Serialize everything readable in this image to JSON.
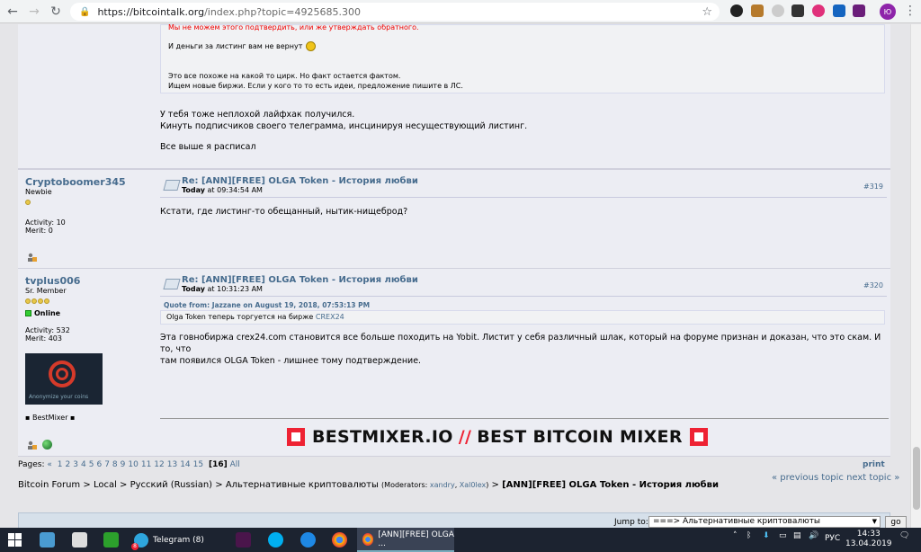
{
  "browser": {
    "url_host": "https://bitcointalk.org",
    "url_path": "/index.php?topic=4925685.300",
    "profile_initials": "Ю"
  },
  "post_prev": {
    "quote_lines": {
      "line1": "Мы не можем этого подтвердить, или же утверждать обратного.",
      "line2": "И деньги за листинг вам не вернут",
      "line3": "Это все похоже на какой то цирк. Но факт остается фактом.",
      "line4": "Ищем новые биржи. Если у кого то то есть идеи, предложение пишите в ЛС."
    },
    "body": {
      "line1": "У тебя тоже неплохой лайфхак получился.",
      "line2": "Кинуть подписчиков своего телеграмма, инсцинируя несуществующий листинг.",
      "line3": "Все выше я расписал"
    }
  },
  "post_319": {
    "author": "Cryptoboomer345",
    "rank": "Newbie",
    "activity": "Activity: 10",
    "merit": "Merit: 0",
    "subject": "Re: [ANN][FREE] OLGA Token - История любви",
    "date_bold": "Today",
    "date_rest": "at 09:34:54 AM",
    "number": "#319",
    "body": "Кстати, где листинг-то обещанный, нытик-нищеброд?"
  },
  "post_320": {
    "author": "tvplus006",
    "rank": "Sr. Member",
    "status": "Online",
    "activity": "Activity: 532",
    "merit": "Merit: 403",
    "avatar_caption": "Anonymize your coins",
    "sig_text": "▪ BestMixer ▪",
    "subject": "Re: [ANN][FREE] OLGA Token - История любви",
    "date_bold": "Today",
    "date_rest": "at 10:31:23 AM",
    "number": "#320",
    "quote_from": "Quote from: Jazzane on August 19, 2018, 07:53:13 PM",
    "quote_text": "Olga Token теперь торгуется на бирже ",
    "quote_link": "CREX24",
    "body_line1": "Эта говнобиржа crex24.com становится все больше походить на Yobit. Листит у себя различный шлак, который на форуме признан и доказан, что это скам. И то, что",
    "body_line2": "там появился  OLGA Token - лишнее тому подтверждение.",
    "banner_left": "BESTMIXER.IO",
    "banner_sep": "//",
    "banner_right": "BEST BITCOIN MIXER"
  },
  "pagination": {
    "label": "Pages:",
    "prev": "«",
    "pages": [
      "1",
      "2",
      "3",
      "4",
      "5",
      "6",
      "7",
      "8",
      "9",
      "10",
      "11",
      "12",
      "13",
      "14",
      "15"
    ],
    "current": "[16]",
    "all": "All",
    "print": "print",
    "prev_next": "« previous topic next topic »"
  },
  "breadcrumb": {
    "part1": "Bitcoin Forum",
    "part2": "Local",
    "part3": "Русский (Russian)",
    "part4": "Альтернативные криптовалюты",
    "mods_prefix": "(Moderators: ",
    "mod1": "xandry",
    "mod2": "Xal0lex",
    "mods_suffix": ")",
    "topic": "[ANN][FREE] OLGA Token - История любви"
  },
  "jump": {
    "label": "Jump to:",
    "value": "===> Альтернативные криптовалюты",
    "go": "go"
  },
  "taskbar": {
    "telegram": "Telegram (8)",
    "telegram_badge": "8",
    "chrome_tab": "[ANN][FREE] OLGA ...",
    "lang": "РУС",
    "time": "14:33",
    "date": "13.04.2019"
  }
}
